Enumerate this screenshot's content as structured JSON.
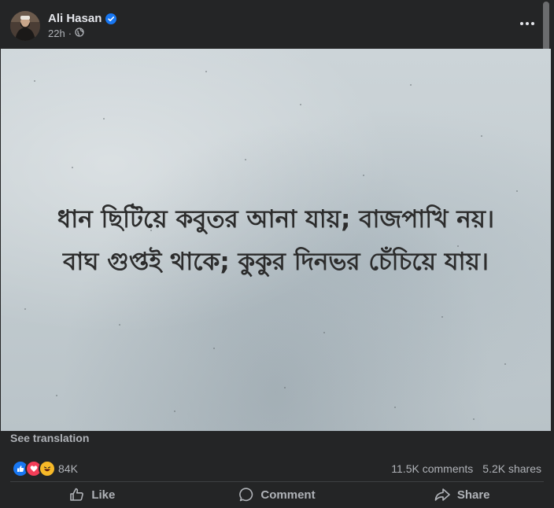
{
  "post": {
    "author": "Ali Hasan",
    "time": "22h",
    "privacy_icon": "globe-icon",
    "verified_icon": "verified-badge-icon",
    "more_icon": "more-options-icon",
    "image_text": {
      "line1": "ধান ছিটিয়ে কবুতর আনা যায়; বাজপাখি নয়।",
      "line2": "বাঘ গুপ্তই থাকে; কুকুর দিনভর চেঁচিয়ে যায়।"
    },
    "see_translation": "See translation"
  },
  "stats": {
    "reaction_icons": [
      "like-reaction-icon",
      "love-reaction-icon",
      "haha-reaction-icon"
    ],
    "reactions": "84K",
    "comments": "11.5K comments",
    "shares": "5.2K shares"
  },
  "actions": {
    "like": "Like",
    "comment": "Comment",
    "share": "Share"
  },
  "colors": {
    "background": "#242526",
    "text_primary": "#e4e6eb",
    "text_secondary": "#b0b3b8",
    "verified": "#1877f2",
    "like": "#1877f2",
    "love": "#f33e58",
    "haha": "#f7b928"
  }
}
